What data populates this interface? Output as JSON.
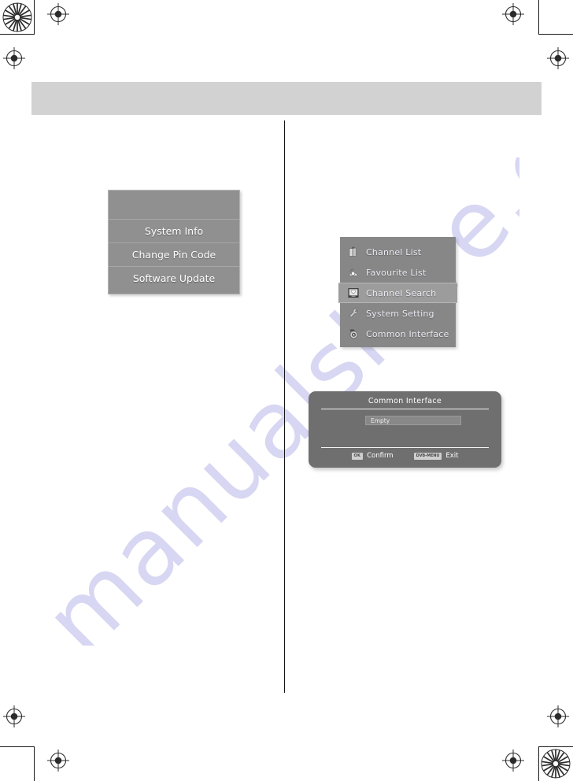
{
  "page": {
    "header_band_label": "",
    "watermark_text": "manualshive.com",
    "watermark_color": "#c9c9ef"
  },
  "registration": {
    "star_target_label": "star-registration-target",
    "crosshair_label": "crosshair-registration-mark",
    "crop_mark_label": "crop-mark"
  },
  "osd_system_menu": {
    "name": "System Setting submenu",
    "blank_row_label": "",
    "items": [
      {
        "label": "System Info"
      },
      {
        "label": "Change Pin Code"
      },
      {
        "label": "Software Update"
      }
    ],
    "background_color": "#909090",
    "text_color": "#ffffff"
  },
  "osd_main_menu": {
    "name": "Main Menu",
    "selected_index": 2,
    "items": [
      {
        "label": "Channel List",
        "icon": "channel-list-icon",
        "selected": false
      },
      {
        "label": "Favourite List",
        "icon": "favourite-list-icon",
        "selected": false
      },
      {
        "label": "Channel Search",
        "icon": "channel-search-icon",
        "selected": true
      },
      {
        "label": "System Setting",
        "icon": "system-setting-icon",
        "selected": false
      },
      {
        "label": "Common Interface",
        "icon": "common-interface-icon",
        "selected": false
      }
    ],
    "background_color": "#878787",
    "highlight_color": "#9c9c9c",
    "text_color": "#e9e9f2"
  },
  "osd_ci_dialog": {
    "title": "Common Interface",
    "slot_value": "Empty",
    "actions": [
      {
        "key": "OK",
        "label": "Confirm"
      },
      {
        "key": "DVB-MENU",
        "label": "Exit"
      }
    ],
    "background_color": "#6f6f6f",
    "title_color": "#ffffff"
  }
}
